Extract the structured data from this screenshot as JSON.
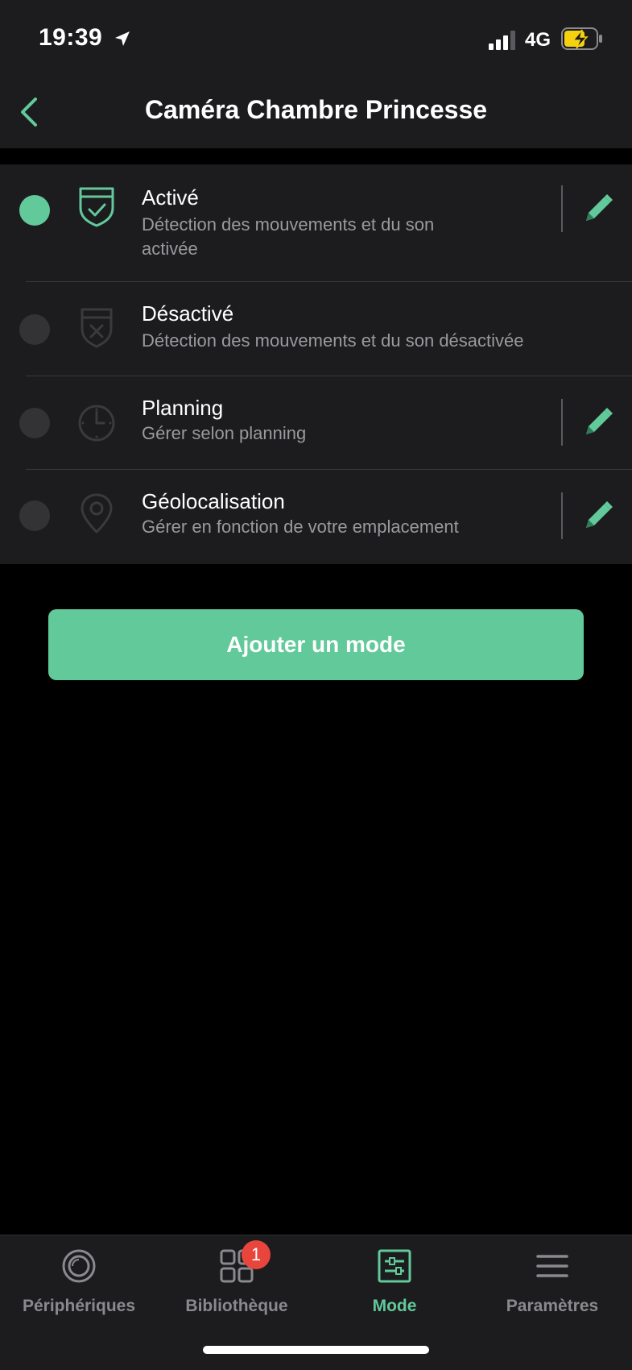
{
  "status_bar": {
    "time": "19:39",
    "network": "4G"
  },
  "header": {
    "title": "Caméra Chambre Princesse"
  },
  "modes": [
    {
      "title": "Activé",
      "desc": "Détection des mouvements et du son activée",
      "icon": "shield-check-icon",
      "selected": true,
      "editable": true
    },
    {
      "title": "Désactivé",
      "desc": "Détection des mouvements et du son désactivée",
      "icon": "shield-x-icon",
      "selected": false,
      "editable": false
    },
    {
      "title": "Planning",
      "desc": "Gérer selon planning",
      "icon": "clock-icon",
      "selected": false,
      "editable": true
    },
    {
      "title": "Géolocalisation",
      "desc": "Gérer en fonction de votre emplacement",
      "icon": "location-pin-icon",
      "selected": false,
      "editable": true
    }
  ],
  "add_button_label": "Ajouter un mode",
  "tabs": [
    {
      "label": "Périphériques",
      "icon": "camera-lens-icon",
      "active": false
    },
    {
      "label": "Bibliothèque",
      "icon": "grid-icon",
      "active": false,
      "badge": "1"
    },
    {
      "label": "Mode",
      "icon": "sliders-icon",
      "active": true
    },
    {
      "label": "Paramètres",
      "icon": "menu-icon",
      "active": false
    }
  ],
  "colors": {
    "accent": "#62c99a",
    "background": "#000000",
    "surface": "#1c1c1e",
    "badge": "#e8453c"
  }
}
